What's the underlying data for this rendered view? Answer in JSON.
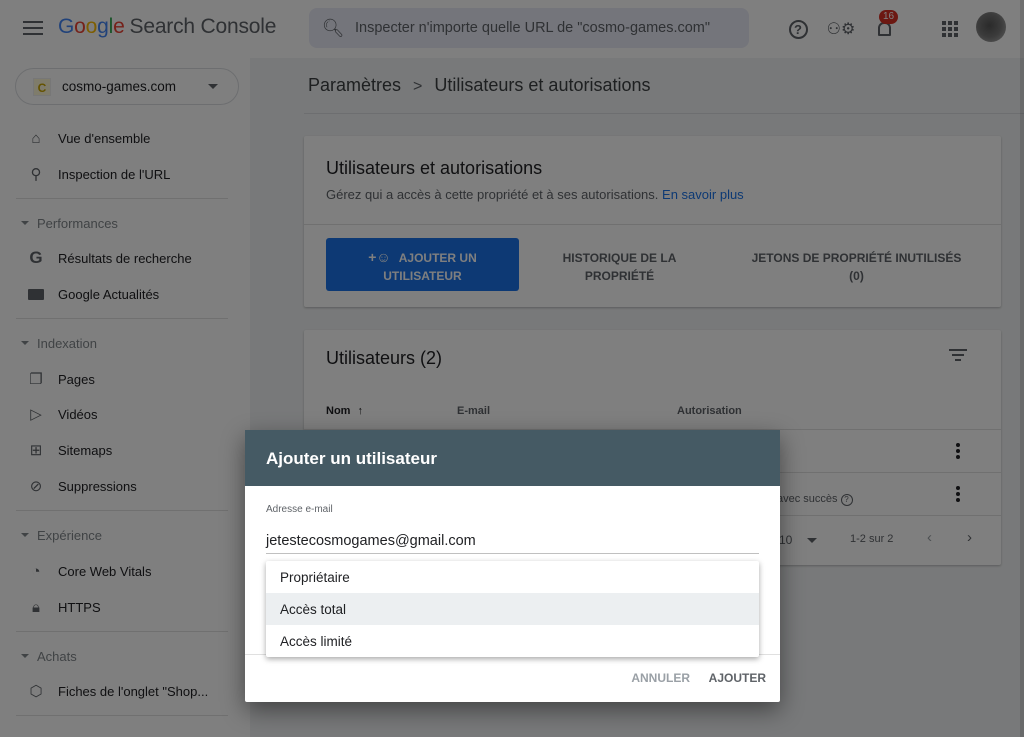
{
  "app": {
    "title_google": [
      "G",
      "o",
      "o",
      "g",
      "l",
      "e"
    ],
    "title_product": "Search Console"
  },
  "search": {
    "placeholder": "Inspecter n'importe quelle URL de \"cosmo-games.com\""
  },
  "topbar": {
    "notification_count": "16",
    "icons": [
      "menu-icon",
      "search-icon",
      "help-icon",
      "admin-settings-icon",
      "notifications-icon",
      "apps-icon",
      "avatar"
    ]
  },
  "property": {
    "icon_letter": "C",
    "name": "cosmo-games.com"
  },
  "sidebar": {
    "top_items": [
      {
        "label": "Vue d'ensemble",
        "icon": "home-icon"
      },
      {
        "label": "Inspection de l'URL",
        "icon": "search-icon"
      }
    ],
    "sections": [
      {
        "label": "Performances",
        "items": [
          {
            "label": "Résultats de recherche",
            "icon": "google-g-icon"
          },
          {
            "label": "Google Actualités",
            "icon": "news-icon"
          }
        ]
      },
      {
        "label": "Indexation",
        "items": [
          {
            "label": "Pages",
            "icon": "pages-icon"
          },
          {
            "label": "Vidéos",
            "icon": "video-icon"
          },
          {
            "label": "Sitemaps",
            "icon": "sitemap-icon"
          },
          {
            "label": "Suppressions",
            "icon": "visibility-off-icon"
          }
        ]
      },
      {
        "label": "Expérience",
        "items": [
          {
            "label": "Core Web Vitals",
            "icon": "speed-icon"
          },
          {
            "label": "HTTPS",
            "icon": "lock-icon"
          }
        ]
      },
      {
        "label": "Achats",
        "items": [
          {
            "label": "Fiches de l'onglet \"Shop...",
            "icon": "tag-icon"
          }
        ]
      }
    ]
  },
  "breadcrumb": {
    "parent": "Paramètres",
    "separator": ">",
    "current": "Utilisateurs et autorisations"
  },
  "permissions_card": {
    "title": "Utilisateurs et autorisations",
    "description": "Gérez qui a accès à cette propriété et à ses autorisations.",
    "learn_more": "En savoir plus",
    "add_user_line1": "AJOUTER UN",
    "add_user_line2": "UTILISATEUR",
    "history_line1": "HISTORIQUE DE LA",
    "history_line2": "PROPRIÉTÉ",
    "tokens_line1": "JETONS DE PROPRIÉTÉ INUTILISÉS",
    "tokens_line2": "(0)"
  },
  "users_card": {
    "title": "Utilisateurs (2)",
    "columns": [
      "Nom",
      "E-mail",
      "Autorisation"
    ],
    "sort_indicator": "↑",
    "row2_status": "avec succès",
    "rows_per_page": "10",
    "range": "1-2 sur 2"
  },
  "dialog": {
    "title": "Ajouter un utilisateur",
    "email_label": "Adresse e-mail",
    "email_value": "jetestecosmogames@gmail.com",
    "permission_options": [
      "Propriétaire",
      "Accès total",
      "Accès limité"
    ],
    "highlighted_option": "Accès total",
    "cancel": "ANNULER",
    "confirm": "AJOUTER"
  },
  "colors": {
    "primary_blue": "#1a73e8",
    "dialog_header": "#455a64",
    "badge_red": "#d93025"
  }
}
